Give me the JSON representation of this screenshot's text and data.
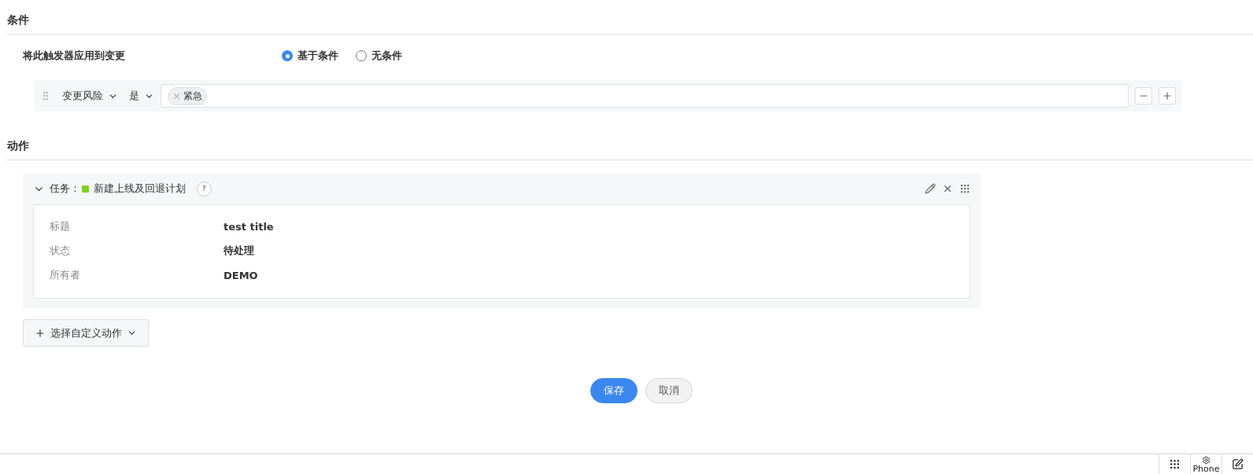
{
  "conditions": {
    "title": "条件",
    "apply_label": "将此触发器应用到变更",
    "modes": [
      {
        "label": "基于条件",
        "selected": true
      },
      {
        "label": "无条件",
        "selected": false
      }
    ],
    "rule": {
      "field": "变更风险",
      "operator": "是",
      "values": [
        "紧急"
      ]
    }
  },
  "actions": {
    "title": "动作",
    "card": {
      "expanded": true,
      "type_label": "任务 :",
      "color": "#7ed321",
      "name": "新建上线及回退计划",
      "help": "?",
      "fields": [
        {
          "label": "标题",
          "value": "test title"
        },
        {
          "label": "状态",
          "value": "待处理"
        },
        {
          "label": "所有者",
          "value": "DEMO"
        }
      ]
    },
    "add_button": "选择自定义动作"
  },
  "buttons": {
    "save": "保存",
    "cancel": "取消"
  },
  "footer": {
    "phone_label": "Phone"
  }
}
